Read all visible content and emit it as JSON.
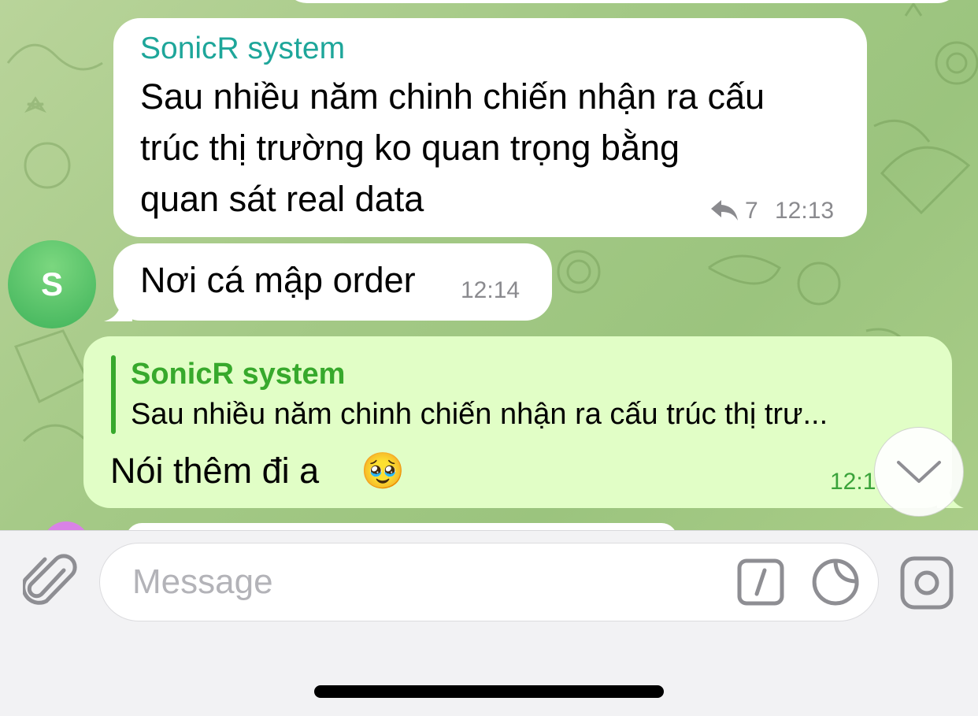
{
  "messages": [
    {
      "sender": "SonicR system",
      "lines": [
        "Sau nhiều năm chinh chiến nhận ra cấu",
        "trúc thị trường ko quan trọng bằng",
        "quan sát real data"
      ],
      "reply_count": "7",
      "time": "12:13"
    },
    {
      "avatar_letter": "S",
      "text": "Nơi cá mập order",
      "time": "12:14"
    },
    {
      "reply": {
        "sender": "SonicR system",
        "text": "Sau nhiều năm chinh chiến nhận ra cấu trúc thị trư..."
      },
      "text": "Nói thêm đi a",
      "emoji": "🥹",
      "time": "12:1"
    }
  ],
  "composer": {
    "placeholder": "Message"
  },
  "icons": [
    "reply-arrow-icon",
    "chevron-down-icon",
    "paperclip-icon",
    "command-slash-icon",
    "sticker-icon",
    "camera-icon"
  ],
  "colors": {
    "sender": "#1ea69a",
    "outgoing_bubble": "#e1fec6",
    "incoming_bubble": "#ffffff",
    "reply_accent": "#37a92c",
    "avatar": "#5bc56c"
  }
}
